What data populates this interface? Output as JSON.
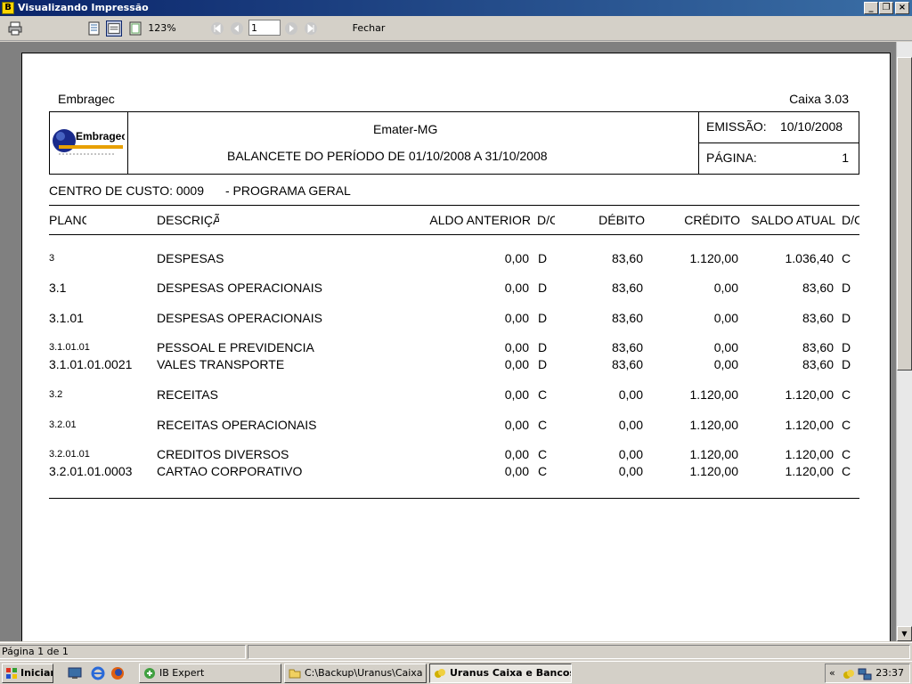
{
  "window": {
    "title": "Visualizando Impressão",
    "app_icon": "B"
  },
  "toolbar": {
    "zoom": "123%",
    "page_value": "1",
    "close_label": "Fechar"
  },
  "report": {
    "company": "Embragec",
    "version": "Caixa 3.03",
    "logo_text": "Embragec",
    "org": "Emater-MG",
    "subtitle": "BALANCETE DO PERÍODO DE 01/10/2008 A 31/10/2008",
    "emission_label": "EMISSÃO:",
    "emission_date": "10/10/2008",
    "page_label": "PÁGINA:",
    "page_number": "1",
    "cost_center": "CENTRO DE CUSTO: 0009",
    "program": "- PROGRAMA GERAL",
    "columns": {
      "plano": "PLANC",
      "descricao": "DESCRIÇÃ",
      "saldo_anterior": "ALDO ANTERIOR",
      "dc1": "D/C",
      "debito": "DÉBITO",
      "credito": "CRÉDITO",
      "saldo_atual": "SALDO ATUAL",
      "dc2": "D/C"
    },
    "rows": [
      {
        "plano": "3",
        "desc": "DESPESAS",
        "saldo_ant": "0,00",
        "dc1": "D",
        "debito": "83,60",
        "credito": "1.120,00",
        "saldo_atual": "1.036,40",
        "dc2": "C"
      },
      {
        "plano": "3.1",
        "desc": "DESPESAS OPERACIONAIS",
        "saldo_ant": "0,00",
        "dc1": "D",
        "debito": "83,60",
        "credito": "0,00",
        "saldo_atual": "83,60",
        "dc2": "D"
      },
      {
        "plano": "3.1.01",
        "desc": "DESPESAS OPERACIONAIS",
        "saldo_ant": "0,00",
        "dc1": "D",
        "debito": "83,60",
        "credito": "0,00",
        "saldo_atual": "83,60",
        "dc2": "D"
      },
      {
        "plano": "3.1.01.01",
        "desc": "PESSOAL E PREVIDENCIA",
        "saldo_ant": "0,00",
        "dc1": "D",
        "debito": "83,60",
        "credito": "0,00",
        "saldo_atual": "83,60",
        "dc2": "D"
      },
      {
        "plano": "3.1.01.01.0021",
        "desc": "VALES TRANSPORTE",
        "saldo_ant": "0,00",
        "dc1": "D",
        "debito": "83,60",
        "credito": "0,00",
        "saldo_atual": "83,60",
        "dc2": "D"
      },
      {
        "plano": "3.2",
        "desc": "RECEITAS",
        "saldo_ant": "0,00",
        "dc1": "C",
        "debito": "0,00",
        "credito": "1.120,00",
        "saldo_atual": "1.120,00",
        "dc2": "C"
      },
      {
        "plano": "3.2.01",
        "desc": "RECEITAS OPERACIONAIS",
        "saldo_ant": "0,00",
        "dc1": "C",
        "debito": "0,00",
        "credito": "1.120,00",
        "saldo_atual": "1.120,00",
        "dc2": "C"
      },
      {
        "plano": "3.2.01.01",
        "desc": "CREDITOS DIVERSOS",
        "saldo_ant": "0,00",
        "dc1": "C",
        "debito": "0,00",
        "credito": "1.120,00",
        "saldo_atual": "1.120,00",
        "dc2": "C"
      },
      {
        "plano": "3.2.01.01.0003",
        "desc": "CARTAO CORPORATIVO",
        "saldo_ant": "0,00",
        "dc1": "C",
        "debito": "0,00",
        "credito": "1.120,00",
        "saldo_atual": "1.120,00",
        "dc2": "C"
      }
    ]
  },
  "status": {
    "page_info": "Página 1 de 1"
  },
  "taskbar": {
    "start_label": "Iniciar",
    "tasks": [
      "IB Expert",
      "C:\\Backup\\Uranus\\Caixa",
      "Uranus Caixa e Bancos"
    ],
    "clock": "23:37"
  }
}
